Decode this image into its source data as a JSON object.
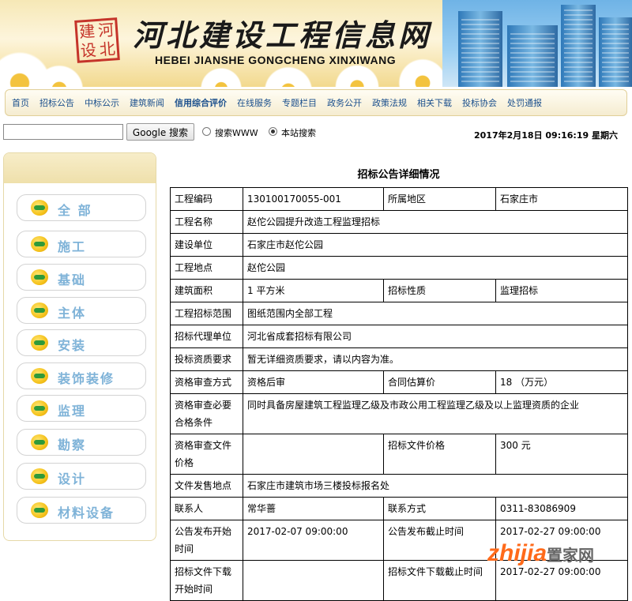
{
  "header": {
    "seal_text": [
      "建",
      "河",
      "设",
      "北"
    ],
    "site_title": "河北建设工程信息网",
    "site_pinyin": "HEBEI JIANSHE GONGCHENG XINXIWANG"
  },
  "nav": {
    "items": [
      "首页",
      "招标公告",
      "中标公示",
      "建筑新闻",
      "信用综合评价",
      "在线服务",
      "专题栏目",
      "政务公开",
      "政策法规",
      "相关下载",
      "投标协会",
      "处罚通报"
    ],
    "active_index": 4
  },
  "search": {
    "input_value": "",
    "button_label": "Google 搜索",
    "radio_www_label": "搜索WWW",
    "radio_site_label": "本站搜索",
    "selected": "site"
  },
  "datetime": "2017年2月18日 09:16:19 星期六",
  "sidebar": {
    "categories": [
      "全 部",
      "施工",
      "基础",
      "主体",
      "安装",
      "装饰装修",
      "监理",
      "勘察",
      "设计",
      "材料设备"
    ]
  },
  "detail": {
    "title": "招标公告详细情况",
    "rows": [
      {
        "l1": "工程编码",
        "v1": "130100170055-001",
        "l2": "所属地区",
        "v2": "石家庄市"
      },
      {
        "l1": "工程名称",
        "v1": "赵佗公园提升改造工程监理招标"
      },
      {
        "l1": "建设单位",
        "v1": "石家庄市赵佗公园"
      },
      {
        "l1": "工程地点",
        "v1": "赵佗公园"
      },
      {
        "l1": "建筑面积",
        "v1": "1 平方米",
        "l2": "招标性质",
        "v2": "监理招标"
      },
      {
        "l1": "工程招标范围",
        "v1": "图纸范围内全部工程"
      },
      {
        "l1": "招标代理单位",
        "v1": "河北省成套招标有限公司"
      },
      {
        "l1": "投标资质要求",
        "v1": "暂无详细资质要求，请以内容为准。"
      },
      {
        "l1": "资格审查方式",
        "v1": "资格后审",
        "l2": "合同估算价",
        "v2": "18 （万元）"
      },
      {
        "l1": "资格审查必要合格条件",
        "v1": "同时具备房屋建筑工程监理乙级及市政公用工程监理乙级及以上监理资质的企业"
      },
      {
        "l1": "资格审查文件价格",
        "v1": "",
        "l2": "招标文件价格",
        "v2": "300 元"
      },
      {
        "l1": "文件发售地点",
        "v1": "石家庄市建筑市场三楼投标报名处"
      },
      {
        "l1": "联系人",
        "v1": "常华蔷",
        "l2": "联系方式",
        "v2": "0311-83086909"
      },
      {
        "l1": "公告发布开始时间",
        "v1": "2017-02-07 09:00:00",
        "l2": "公告发布截止时间",
        "v2": "2017-02-27 09:00:00"
      },
      {
        "l1": "招标文件下载开始时间",
        "v1": "",
        "l2": "招标文件下载截止时间",
        "v2": "2017-02-27 09:00:00"
      }
    ]
  },
  "watermark": {
    "brand": "zhijia",
    "suffix": "置家网"
  }
}
